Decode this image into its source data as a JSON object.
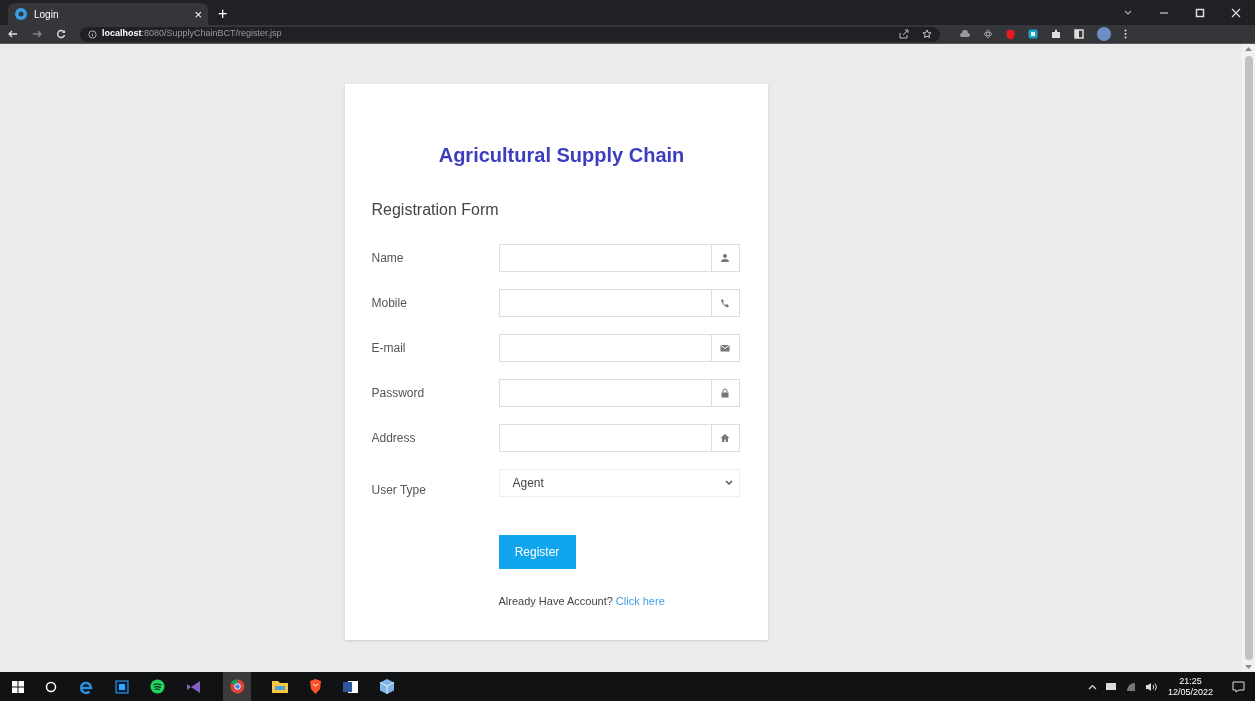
{
  "browser": {
    "tab_title": "Login",
    "tab_close": "×",
    "new_tab": "+",
    "url": "**localhost**:8080/SupplyChainBCT/register.jsp"
  },
  "form": {
    "title": "Agricultural Supply Chain",
    "subtitle": "Registration Form",
    "fields": [
      {
        "kind": "input",
        "label": "Name"
      },
      {
        "kind": "input",
        "label": "Mobile"
      },
      {
        "kind": "input",
        "label": "E-mail"
      },
      {
        "kind": "input",
        "label": "Password"
      },
      {
        "kind": "input",
        "label": "Address"
      },
      {
        "kind": "select",
        "label": "User Type",
        "value": "Agent"
      }
    ],
    "button": "Register",
    "footer_text": "Already Have Account?",
    "footer_link": "Click here"
  },
  "taskbar": {
    "time": "21:25",
    "date": "12/05/2022"
  }
}
